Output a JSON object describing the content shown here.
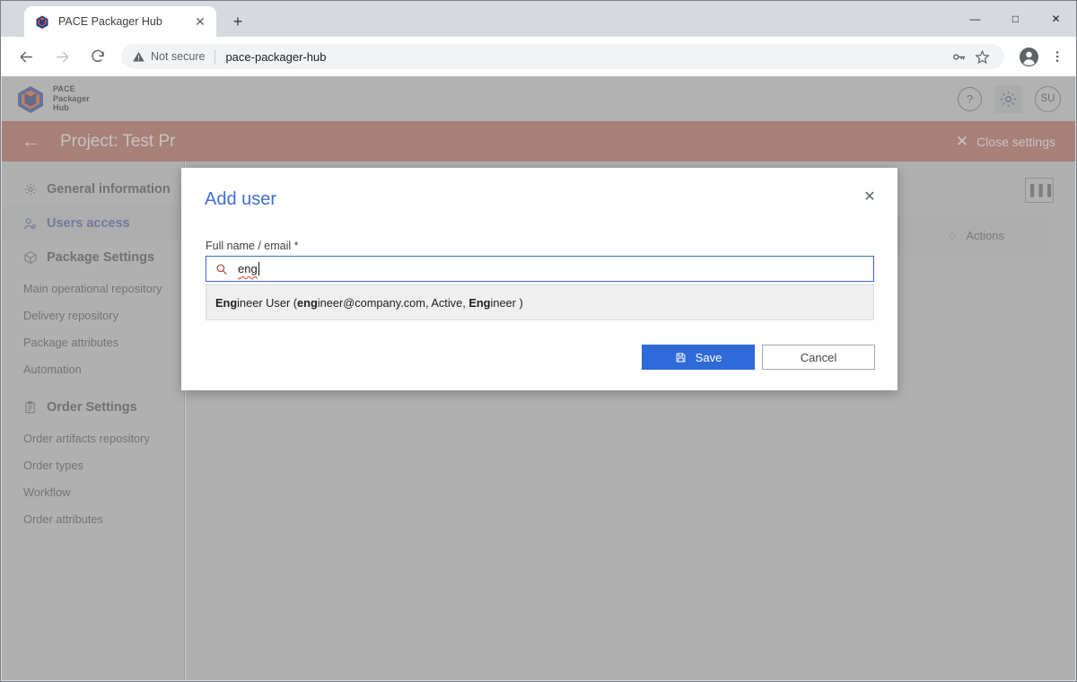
{
  "browser": {
    "tab": {
      "title": "PACE Packager Hub",
      "close_label": "✕",
      "favicon": "pace-cube-favicon"
    },
    "new_tab_label": "+",
    "window_controls": {
      "minimize": "—",
      "maximize": "□",
      "close": "✕"
    },
    "nav": {
      "back": "←",
      "forward": "→",
      "reload": "↻"
    },
    "omnibox": {
      "security_label": "Not secure",
      "url": "pace-packager-hub",
      "security_icon": "warning-triangle-icon",
      "key_icon": "key-icon",
      "star_icon": "star-icon",
      "profile_icon": "profile-avatar-icon",
      "menu_icon": "three-dot-menu-icon"
    }
  },
  "app": {
    "logo": {
      "line1": "PACE",
      "line2": "Packager",
      "line3": "Hub"
    },
    "header": {
      "help_label": "?",
      "gear_icon": "gear-icon",
      "user_initials": "SU"
    },
    "project_bar": {
      "back_icon": "back-arrow-icon",
      "title": "Project: Test Pr",
      "close_settings_label": "Close settings",
      "close_settings_icon": "close-x-icon"
    },
    "sidebar": {
      "items": [
        {
          "label": "General information",
          "icon": "gear-icon",
          "type": "group",
          "active": false
        },
        {
          "label": "Users access",
          "icon": "users-icon",
          "type": "group",
          "active": true
        },
        {
          "label": "Package Settings",
          "icon": "package-icon",
          "type": "group",
          "active": false
        },
        {
          "label": "Main operational repository",
          "type": "sub"
        },
        {
          "label": "Delivery repository",
          "type": "sub"
        },
        {
          "label": "Package attributes",
          "type": "sub"
        },
        {
          "label": "Automation",
          "type": "sub"
        },
        {
          "label": "Order Settings",
          "icon": "clipboard-icon",
          "type": "group",
          "active": false
        },
        {
          "label": "Order artifacts repository",
          "type": "sub"
        },
        {
          "label": "Order types",
          "type": "sub"
        },
        {
          "label": "Workflow",
          "type": "sub"
        },
        {
          "label": "Order attributes",
          "type": "sub"
        }
      ]
    },
    "main": {
      "columns_button_icon": "columns-chooser-icon",
      "columns_button_label": "▐▐▐",
      "table_header": {
        "actions_label": "Actions",
        "sort_icon": "sort-updown-icon"
      }
    }
  },
  "modal": {
    "title": "Add user",
    "close_label": "✕",
    "field_label": "Full name / email",
    "required_marker": "*",
    "search_icon": "search-magnifier-icon",
    "search_value": "eng",
    "suggestions": [
      {
        "prefix_bold": "Eng",
        "rest": "ineer User (",
        "email_bold": "eng",
        "email_rest": "ineer@company.com, Active, ",
        "role_bold": "Eng",
        "role_rest": "ineer )",
        "full_text": "Engineer User (engineer@company.com, Active, Engineer )"
      }
    ],
    "save_label": "Save",
    "save_icon": "save-disk-icon",
    "cancel_label": "Cancel"
  },
  "colors": {
    "accent_blue": "#2f6ad9",
    "title_blue": "#3f6fd6",
    "project_bar": "#b05a48",
    "sidebar_bg": "#c4c4c4",
    "active_nav": "#3f4a9e"
  }
}
